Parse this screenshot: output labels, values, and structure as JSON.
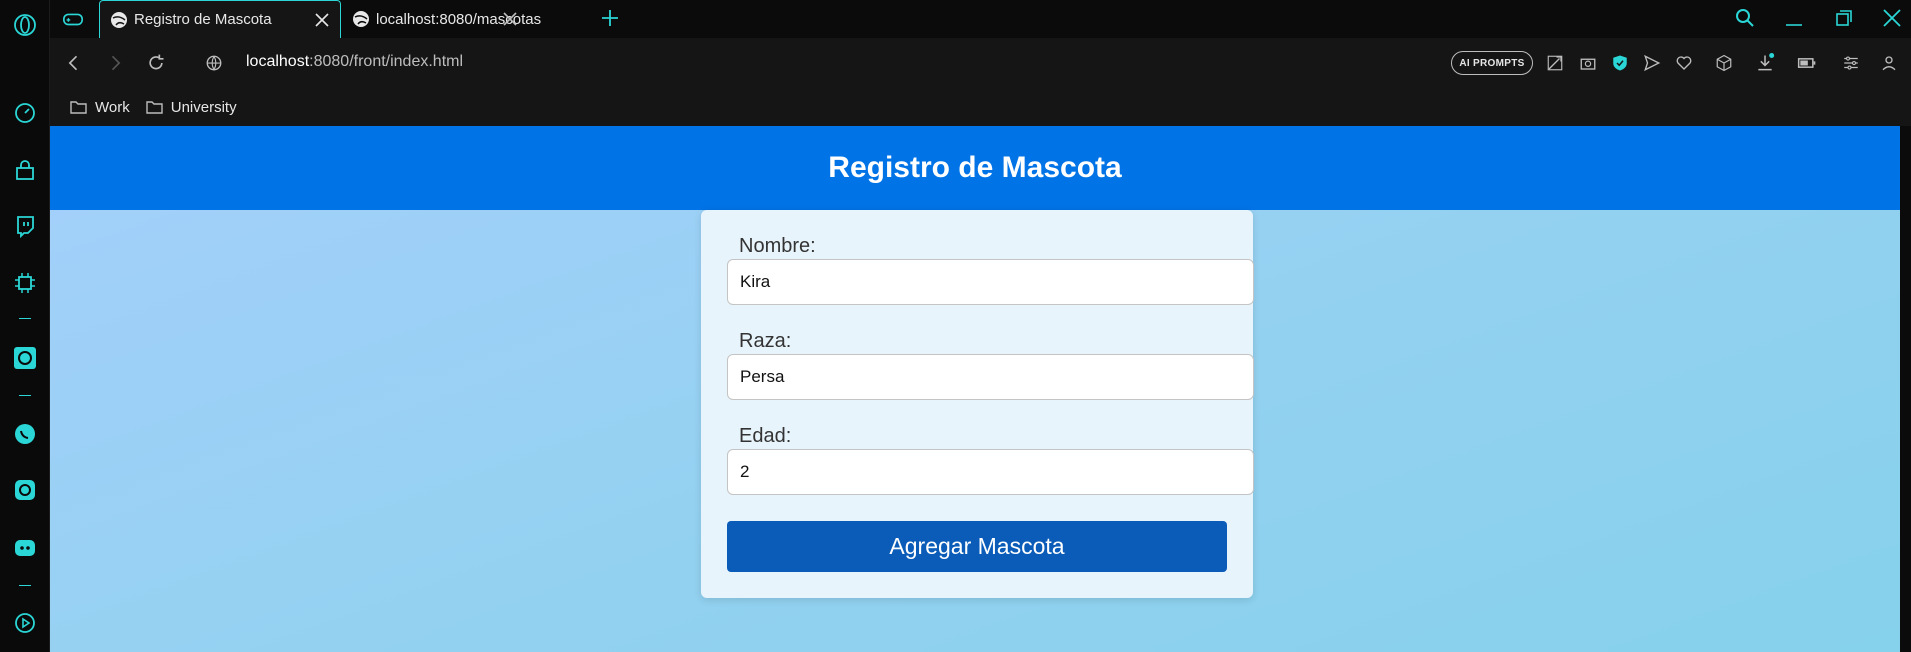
{
  "browser": {
    "tabs": [
      {
        "title": "Registro de Mascota",
        "active": true
      },
      {
        "title": "localhost:8080/mascotas",
        "active": false
      }
    ],
    "url": {
      "host": "localhost",
      "rest": ":8080/front/index.html"
    },
    "ai_prompts_label": "AI PROMPTS",
    "bookmarks": [
      {
        "label": "Work"
      },
      {
        "label": "University"
      }
    ],
    "accent_color": "#2bd6d6"
  },
  "page": {
    "title": "Registro de Mascota",
    "header_color": "#0073e6",
    "form": {
      "fields": [
        {
          "label": "Nombre:",
          "value": "Kira"
        },
        {
          "label": "Raza:",
          "value": "Persa"
        },
        {
          "label": "Edad:",
          "value": "2"
        }
      ],
      "submit_label": "Agregar Mascota",
      "button_color": "#0a5cb8"
    }
  }
}
